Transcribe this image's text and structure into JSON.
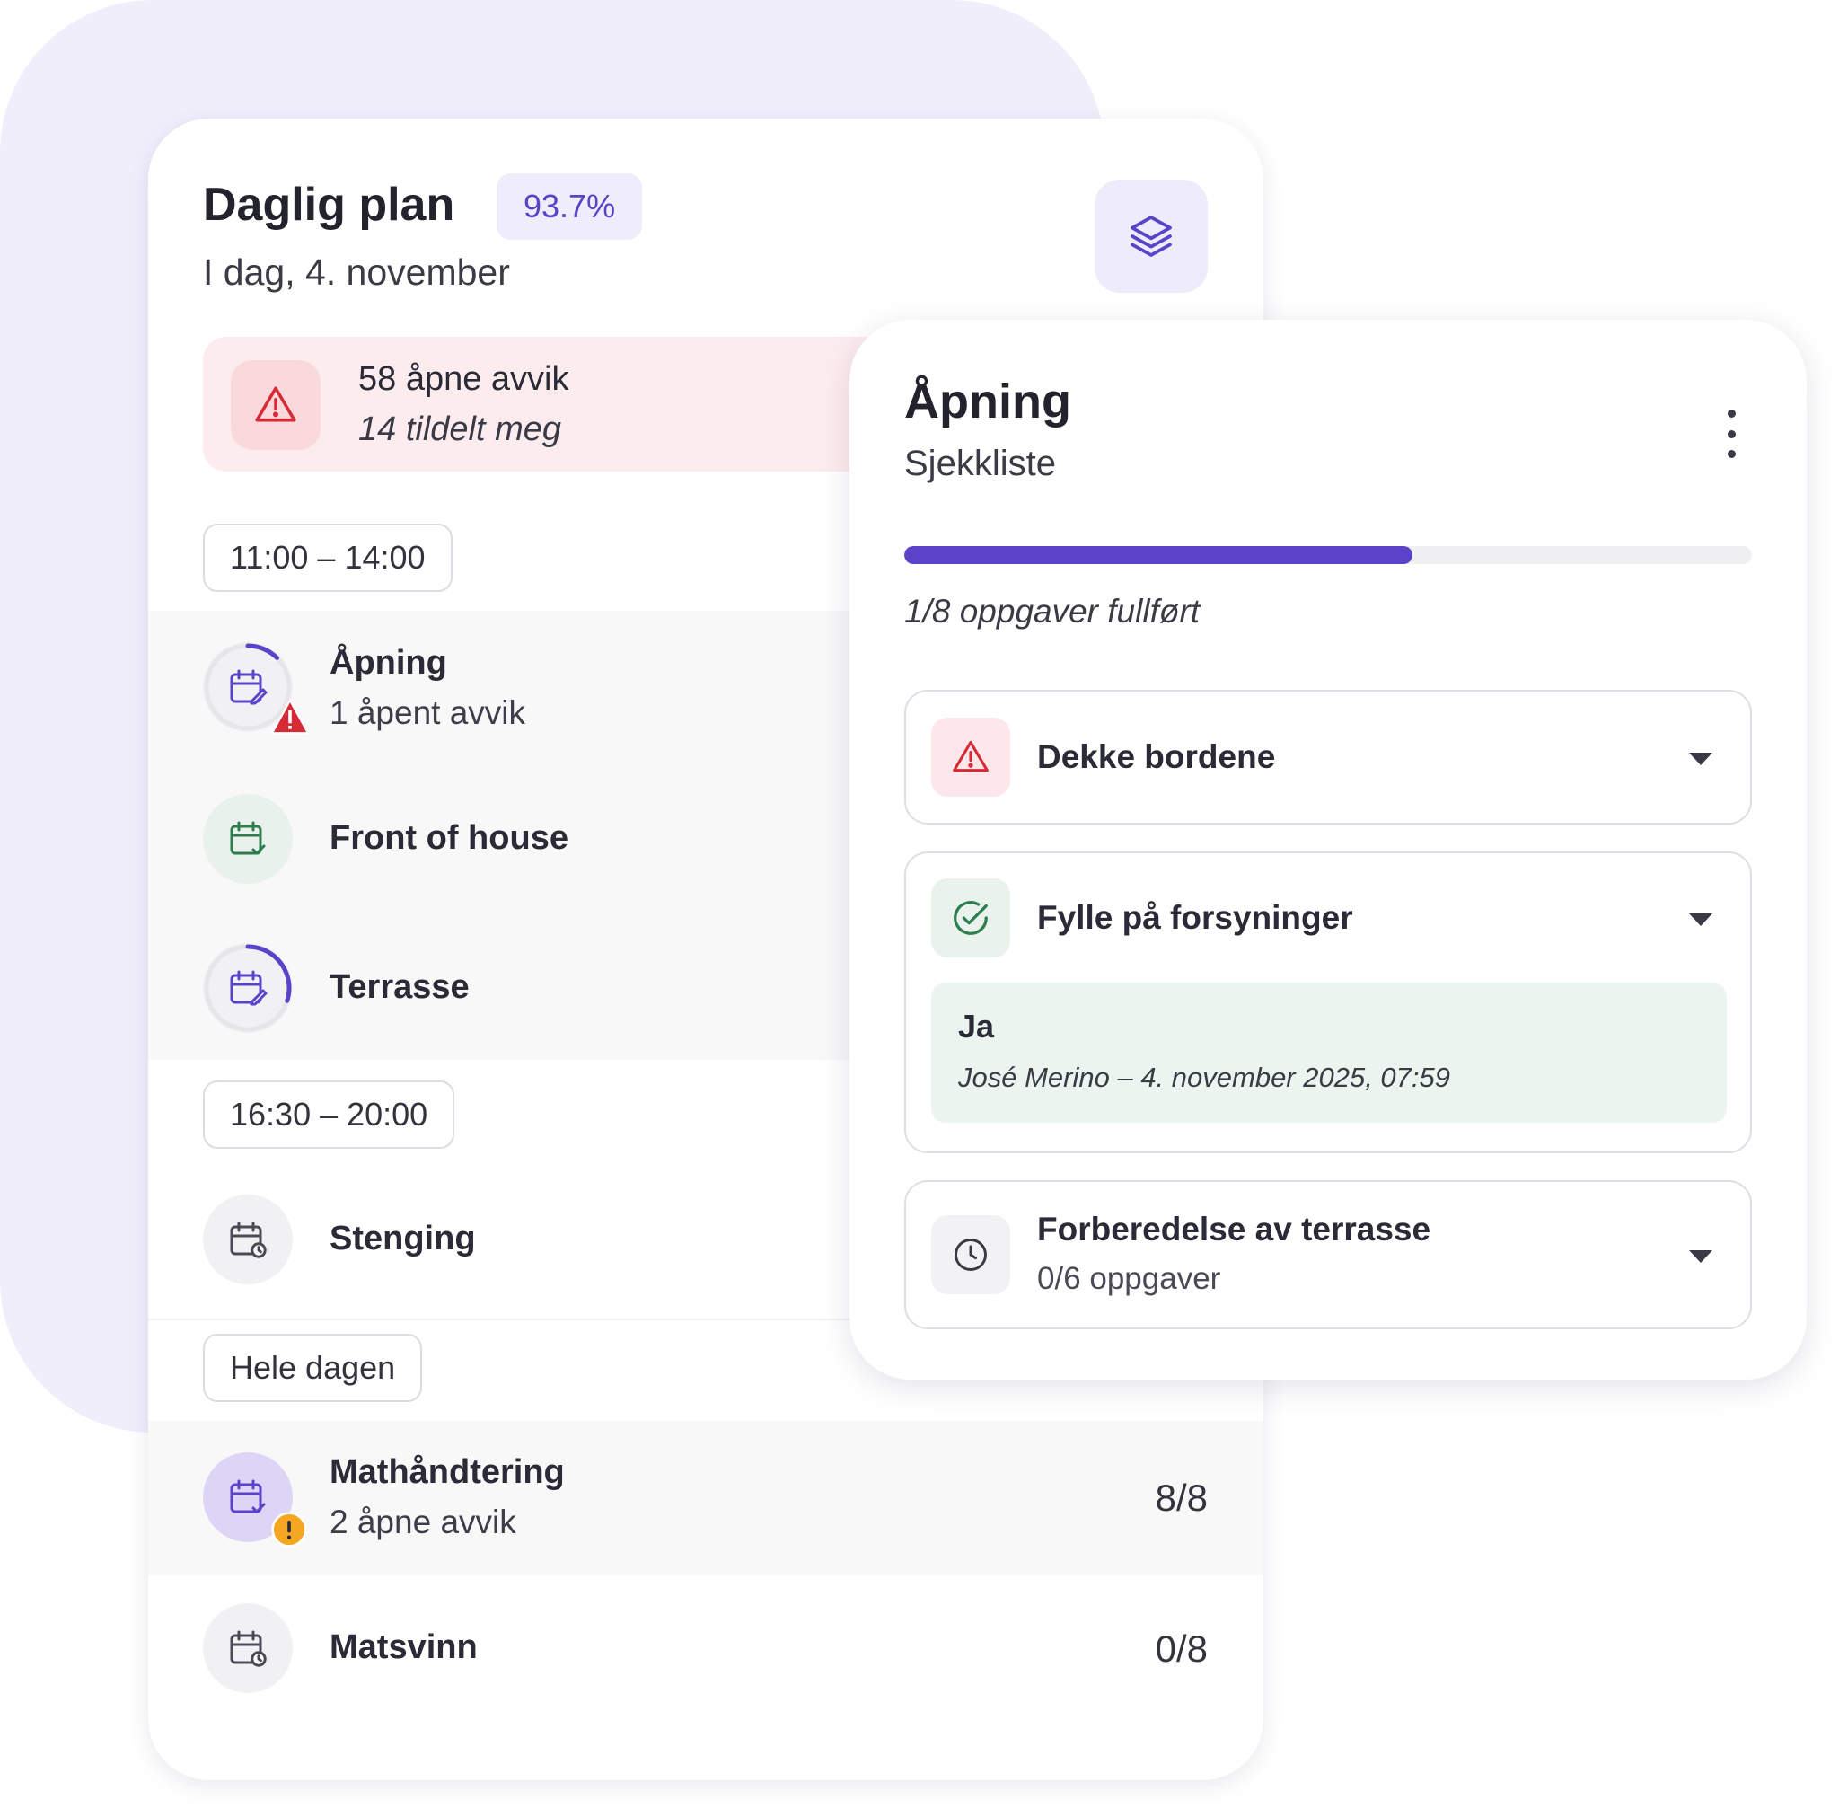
{
  "plan": {
    "title": "Daglig plan",
    "completion_badge": "93.7%",
    "date": "I dag, 4. november",
    "alert": {
      "title": "58 åpne avvik",
      "subtitle": "14 tildelt meg"
    },
    "groups": [
      {
        "time": "11:00 – 14:00",
        "items": [
          {
            "title": "Åpning",
            "subtitle": "1 åpent avvik",
            "icon": "calendar-edit-icon",
            "status": "in-progress",
            "progress": 0.125,
            "badge": "warning-triangle-icon"
          },
          {
            "title": "Front of house",
            "icon": "calendar-check-icon",
            "status": "done"
          },
          {
            "title": "Terrasse",
            "icon": "calendar-edit-icon",
            "status": "in-progress",
            "progress": 0.3
          }
        ]
      },
      {
        "time": "16:30 – 20:00",
        "items": [
          {
            "title": "Stenging",
            "icon": "calendar-clock-icon",
            "status": "pending"
          }
        ]
      },
      {
        "time": "Hele dagen",
        "items": [
          {
            "title": "Mathåndtering",
            "subtitle": "2 åpne avvik",
            "icon": "calendar-check-icon",
            "status": "done",
            "count": "8/8",
            "badge": "warning-circle-icon"
          },
          {
            "title": "Matsvinn",
            "icon": "calendar-clock-icon",
            "status": "pending",
            "count": "0/8"
          }
        ]
      }
    ]
  },
  "checklist": {
    "title": "Åpning",
    "subtitle": "Sjekkliste",
    "progress": 0.6,
    "progress_label": "1/8 oppgaver fullført",
    "tasks": [
      {
        "title": "Dekke bordene",
        "icon": "warning-triangle-icon",
        "status": "deviation"
      },
      {
        "title": "Fylle på forsyninger",
        "icon": "check-circle-icon",
        "status": "done",
        "answer": "Ja",
        "answer_meta": "José Merino – 4. november 2025, 07:59"
      },
      {
        "title": "Forberedelse av terrasse",
        "subtitle": "0/6 oppgaver",
        "icon": "clock-icon",
        "status": "pending"
      }
    ]
  },
  "colors": {
    "accent": "#5b43c9",
    "danger": "#d62b37",
    "success": "#2e7d4f",
    "warning": "#f5a623",
    "background_blob": "#f1eefc"
  }
}
